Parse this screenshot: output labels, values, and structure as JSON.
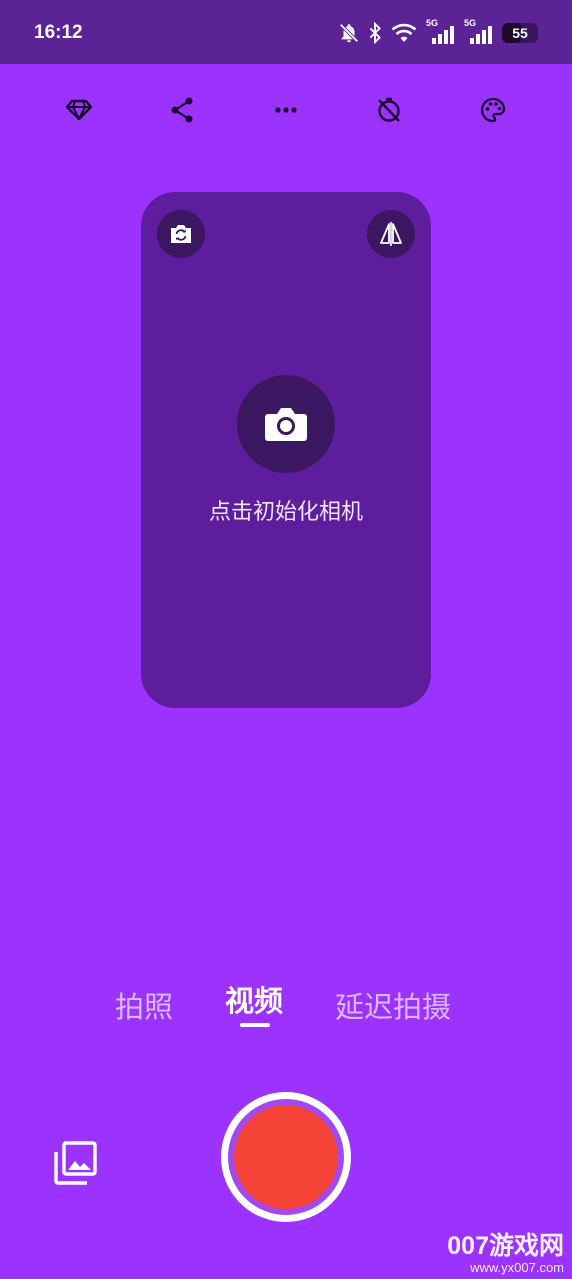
{
  "status_bar": {
    "time": "16:12",
    "icons": [
      "bell-off-icon",
      "bluetooth-icon",
      "wifi-icon",
      "signal-5g-icon",
      "signal-5g-icon",
      "battery-icon"
    ],
    "network_label_1": "5G",
    "network_label_2": "5G",
    "battery_level": "55"
  },
  "toolbar": {
    "icons": [
      "diamond-icon",
      "share-icon",
      "more-icon",
      "timer-off-icon",
      "palette-icon"
    ]
  },
  "preview": {
    "switch_camera_icon": "switch-camera-icon",
    "mirror_icon": "mirror-flip-icon",
    "camera_icon": "camera-icon",
    "init_label": "点击初始化相机"
  },
  "modes": {
    "items": [
      "拍照",
      "视频",
      "延迟拍摄"
    ],
    "active": "视频"
  },
  "bottom": {
    "gallery_icon": "gallery-icon",
    "shutter_icon": "record-button"
  },
  "watermark": {
    "title": "007游戏网",
    "url": "www.yx007.com"
  },
  "colors": {
    "background": "#9b32fd",
    "status_bar": "#5b2396",
    "preview_card": "#5d1d9c",
    "record_red": "#f44336"
  }
}
